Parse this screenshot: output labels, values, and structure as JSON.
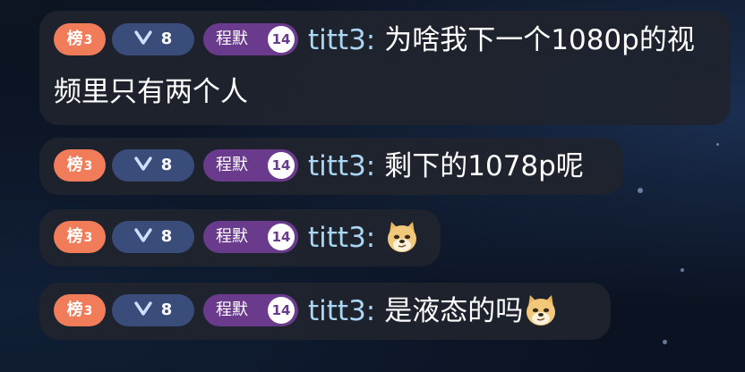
{
  "messages": [
    {
      "rank_badge": {
        "label": "榜",
        "num": "3"
      },
      "level_badge": {
        "level": "8"
      },
      "fan_badge": {
        "name": "程默",
        "level": "14"
      },
      "username": "titt3:",
      "text": "为啥我下一个1080p的视频里只有两个人",
      "emoji": ""
    },
    {
      "rank_badge": {
        "label": "榜",
        "num": "3"
      },
      "level_badge": {
        "level": "8"
      },
      "fan_badge": {
        "name": "程默",
        "level": "14"
      },
      "username": "titt3:",
      "text": "剩下的1078p呢",
      "emoji": ""
    },
    {
      "rank_badge": {
        "label": "榜",
        "num": "3"
      },
      "level_badge": {
        "level": "8"
      },
      "fan_badge": {
        "name": "程默",
        "level": "14"
      },
      "username": "titt3:",
      "text": "",
      "emoji": "doge-emoji"
    },
    {
      "rank_badge": {
        "label": "榜",
        "num": "3"
      },
      "level_badge": {
        "level": "8"
      },
      "fan_badge": {
        "name": "程默",
        "level": "14"
      },
      "username": "titt3:",
      "text": "是液态的吗",
      "emoji": "doge-emoji"
    }
  ],
  "colors": {
    "rank_badge": "#f07c5a",
    "level_badge": "#3a4d7a",
    "fan_badge": "#6a3b8c",
    "username": "#a9d6f2",
    "bubble": "#20242e"
  }
}
